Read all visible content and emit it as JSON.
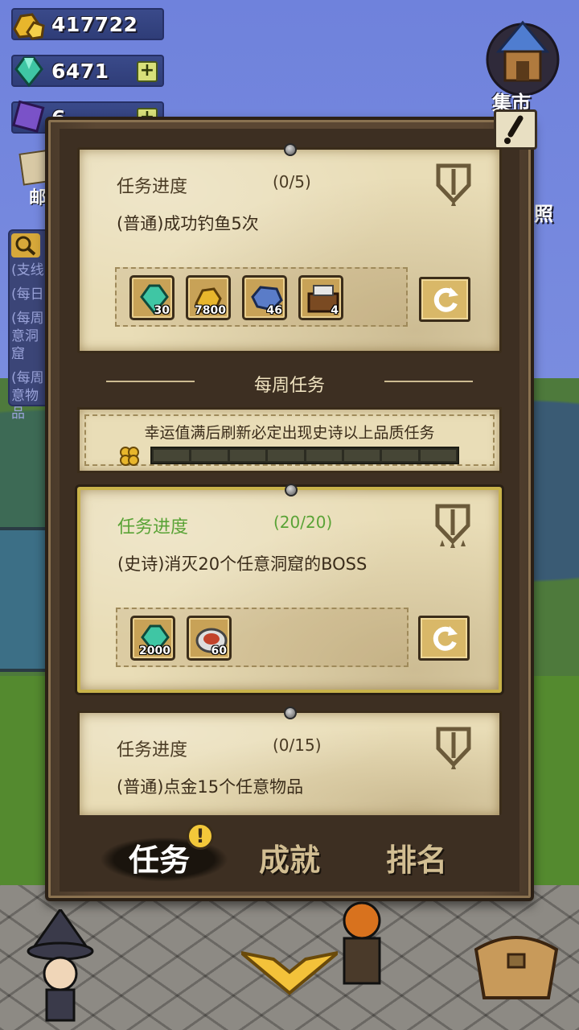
{
  "currencies": {
    "gold": {
      "value": "417722",
      "icon": "gold-ore-icon"
    },
    "gems": {
      "value": "6471",
      "icon": "green-gem-icon"
    },
    "scrolls": {
      "value": "6",
      "icon": "purple-scroll-icon"
    }
  },
  "side_buttons": {
    "mail_label": "邮",
    "market_label": "集市",
    "photo_label": "照"
  },
  "side_events": [
    "(支线",
    "(每日)",
    "(每周)",
    "意洞窟",
    "(每周)",
    "意物品"
  ],
  "quests": [
    {
      "progress_label": "任务进度",
      "progress_value": "(0/5)",
      "description": "(普通)成功钓鱼5次",
      "rewards": [
        {
          "icon": "green-gem-icon",
          "qty": "30"
        },
        {
          "icon": "gold-ore-icon",
          "qty": "7800"
        },
        {
          "icon": "iron-ore-icon",
          "qty": "46"
        },
        {
          "icon": "treasure-chest-icon",
          "qty": "4"
        }
      ]
    },
    {
      "progress_label": "任务进度",
      "progress_value": "(20/20)",
      "description": "(史诗)消灭20个任意洞窟的BOSS",
      "rewards": [
        {
          "icon": "green-gem-icon",
          "qty": "2000"
        },
        {
          "icon": "meat-bowl-icon",
          "qty": "60"
        }
      ]
    },
    {
      "progress_label": "任务进度",
      "progress_value": "(0/15)",
      "description": "(普通)点金15个任意物品"
    }
  ],
  "weekly_section_title": "每周任务",
  "luck": {
    "text": "幸运值满后刷新必定出现史诗以上品质任务",
    "segments_filled": 0,
    "segments_total": 8
  },
  "tabs": {
    "quests": "任务",
    "achievements": "成就",
    "ranking": "排名",
    "alert_glyph": "!"
  },
  "colors": {
    "complete_text": "#5aa336",
    "parchment": "#e9ddb7",
    "wood": "#5b4733"
  }
}
